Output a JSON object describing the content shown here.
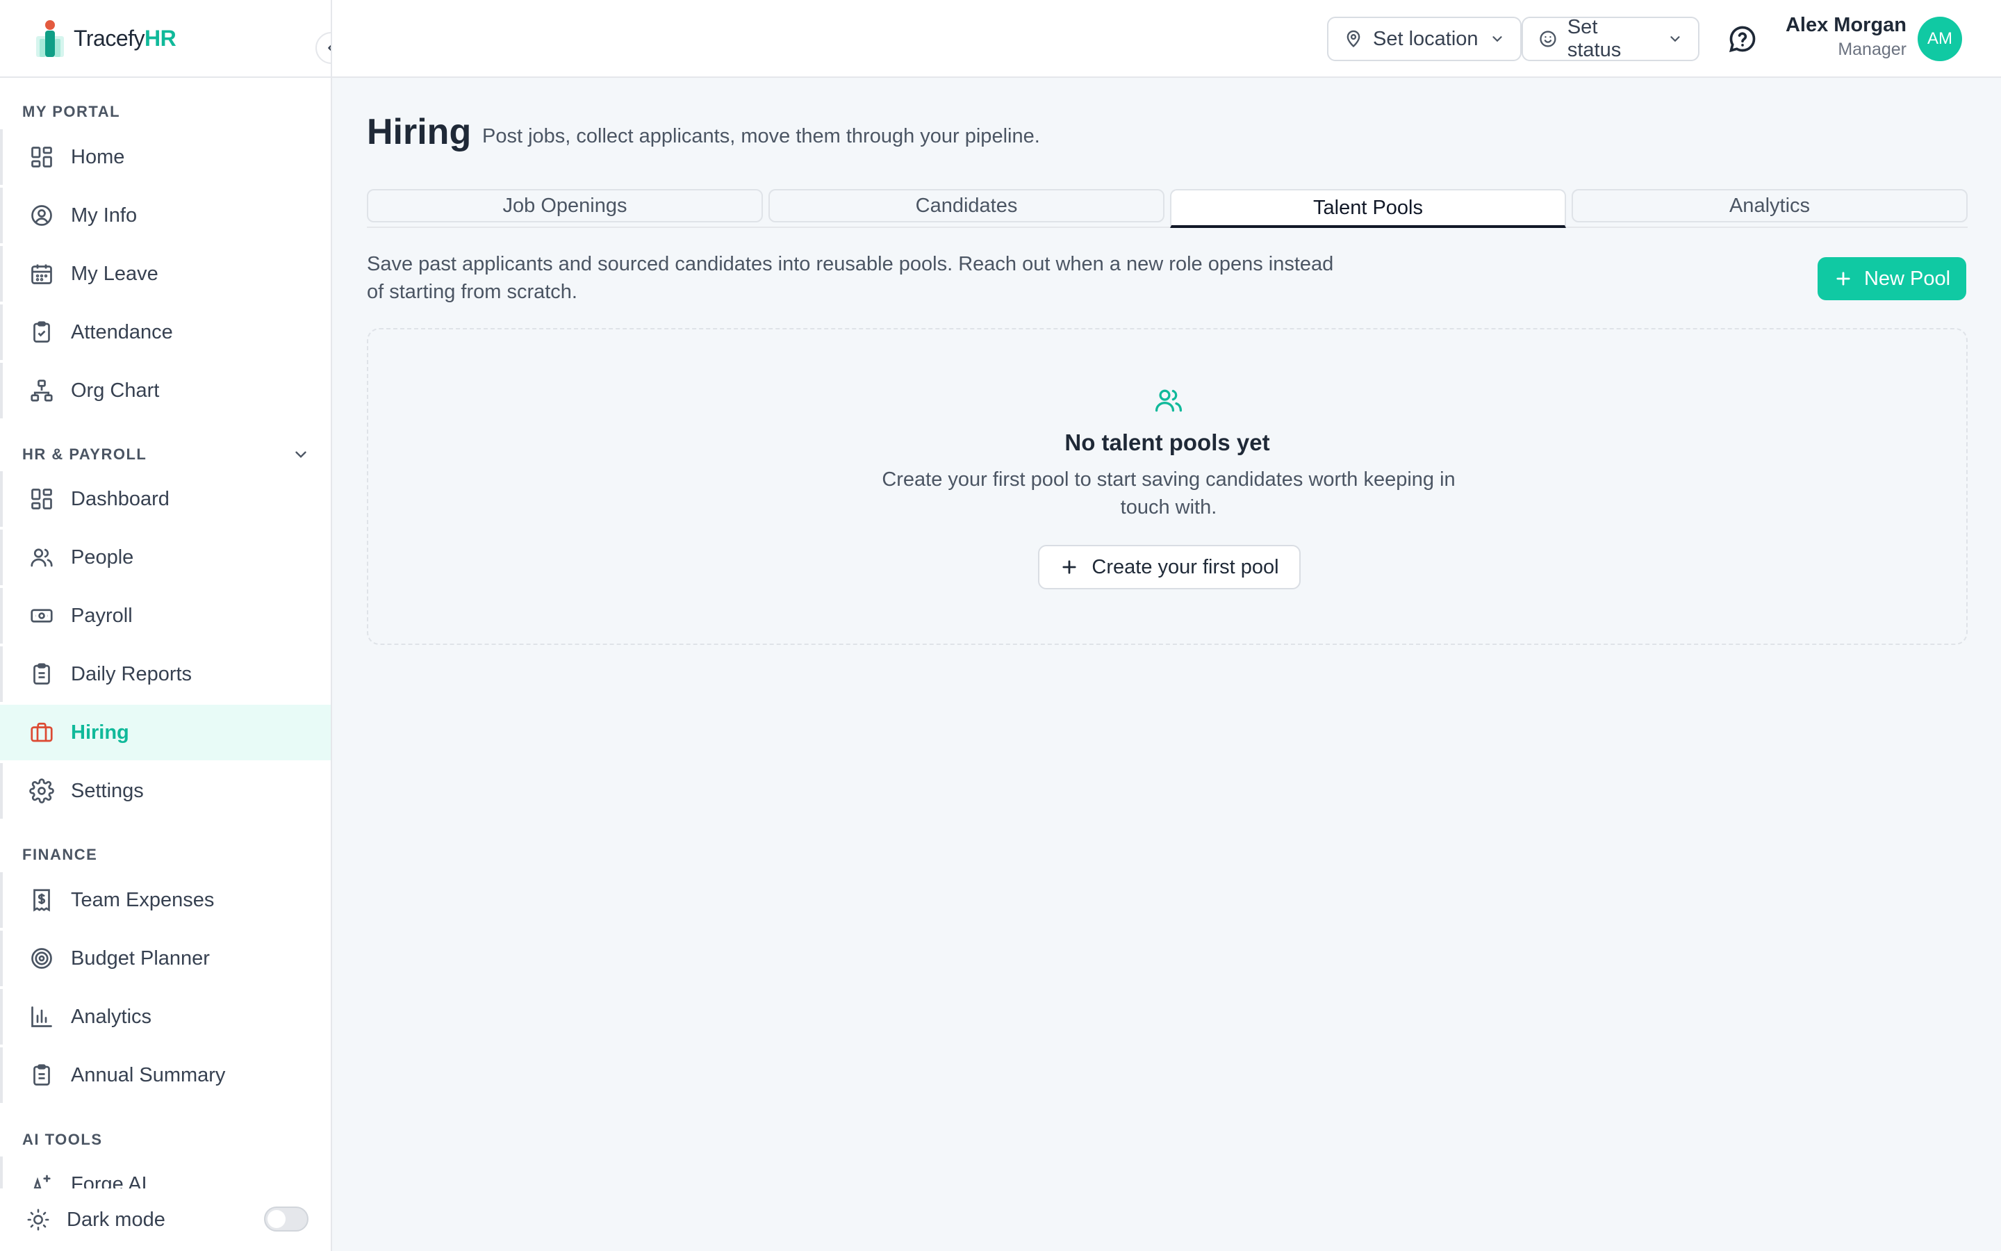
{
  "brand": {
    "name_part1": "Tracefy",
    "name_part2": "HR"
  },
  "sidebar": {
    "sections": [
      {
        "label": "MY PORTAL"
      },
      {
        "label": "HR & PAYROLL"
      },
      {
        "label": "FINANCE"
      },
      {
        "label": "AI TOOLS"
      }
    ],
    "items": [
      {
        "label": "Home",
        "icon": "grid-icon"
      },
      {
        "label": "My Info",
        "icon": "user-circle-icon"
      },
      {
        "label": "My Leave",
        "icon": "calendar-icon"
      },
      {
        "label": "Attendance",
        "icon": "clipboard-check-icon"
      },
      {
        "label": "Org Chart",
        "icon": "org-chart-icon"
      },
      {
        "label": "Dashboard",
        "icon": "grid-icon"
      },
      {
        "label": "People",
        "icon": "users-icon"
      },
      {
        "label": "Payroll",
        "icon": "banknote-icon"
      },
      {
        "label": "Daily Reports",
        "icon": "clipboard-list-icon"
      },
      {
        "label": "Hiring",
        "icon": "briefcase-icon",
        "active": true
      },
      {
        "label": "Settings",
        "icon": "gear-icon"
      },
      {
        "label": "Team Expenses",
        "icon": "receipt-icon"
      },
      {
        "label": "Budget Planner",
        "icon": "target-icon"
      },
      {
        "label": "Analytics",
        "icon": "bar-chart-icon"
      },
      {
        "label": "Annual Summary",
        "icon": "clipboard-list-icon"
      },
      {
        "label": "Forge AI",
        "icon": "sparkle-icon"
      }
    ],
    "dark_mode_label": "Dark mode",
    "dark_mode_on": false
  },
  "topbar": {
    "location_label": "Set location",
    "status_label": "Set status",
    "user_name": "Alex Morgan",
    "user_role": "Manager",
    "avatar_initials": "AM"
  },
  "page": {
    "title": "Hiring",
    "subtitle": "Post jobs, collect applicants, move them through your pipeline."
  },
  "tabs": [
    {
      "label": "Job Openings"
    },
    {
      "label": "Candidates"
    },
    {
      "label": "Talent Pools",
      "active": true
    },
    {
      "label": "Analytics"
    }
  ],
  "talent_pools": {
    "description": "Save past applicants and sourced candidates into reusable pools. Reach out when a new role opens instead of starting from scratch.",
    "new_pool_label": "New Pool",
    "empty_title": "No talent pools yet",
    "empty_text": "Create your first pool to start saving candidates worth keeping in touch with.",
    "create_label": "Create your first pool"
  },
  "colors": {
    "accent": "#10c9a3",
    "accent_text": "#10b99a",
    "active_bg": "#e8fbf7",
    "active_icon": "#dc4a33"
  }
}
